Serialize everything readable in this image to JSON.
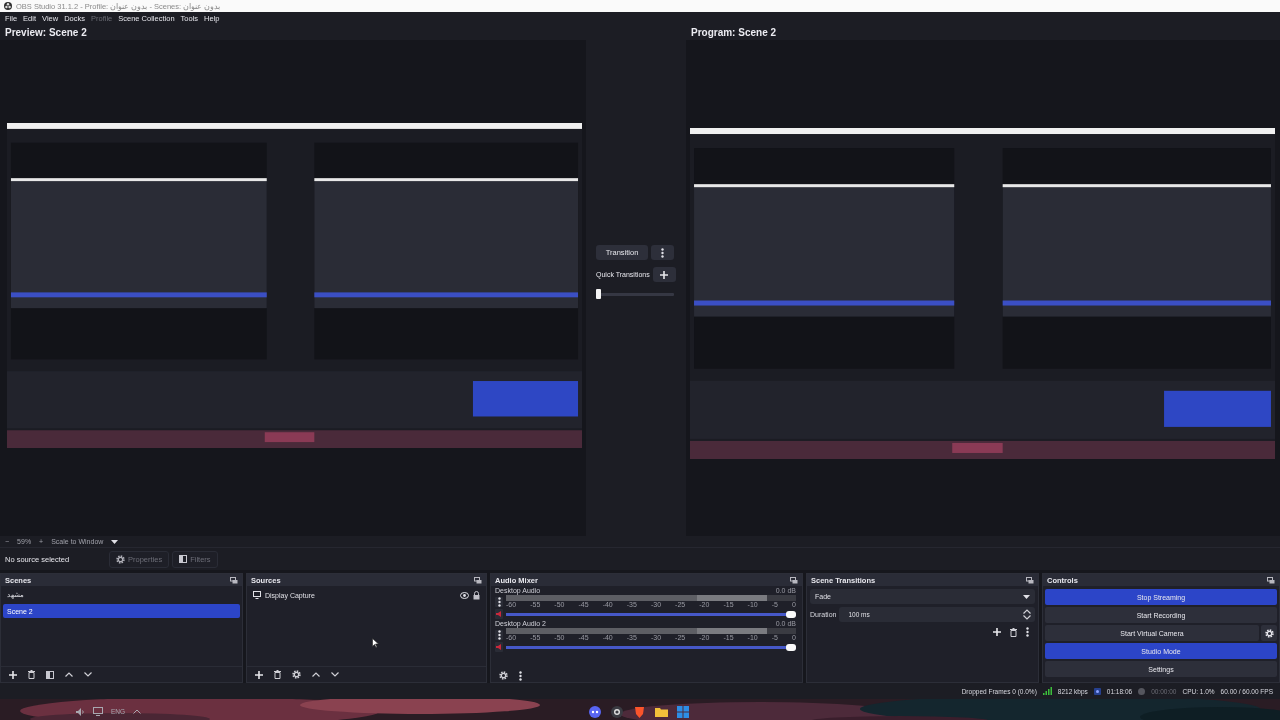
{
  "window": {
    "title": "OBS Studio 31.1.2 - Profile: بدون عنوان - Scenes: بدون عنوان"
  },
  "menu": [
    {
      "label": "File",
      "disabled": false
    },
    {
      "label": "Edit",
      "disabled": false
    },
    {
      "label": "View",
      "disabled": false
    },
    {
      "label": "Docks",
      "disabled": false
    },
    {
      "label": "Profile",
      "disabled": true
    },
    {
      "label": "Scene Collection",
      "disabled": false
    },
    {
      "label": "Tools",
      "disabled": false
    },
    {
      "label": "Help",
      "disabled": false
    }
  ],
  "preview": {
    "title": "Preview: Scene 2",
    "zoom_out": "−",
    "zoom": "59%",
    "zoom_in": "+",
    "scale_mode": "Scale to Window"
  },
  "transition_panel": {
    "transition_button": "Transition",
    "quick_transitions": "Quick Transitions",
    "level": 0
  },
  "program": {
    "title": "Program: Scene 2"
  },
  "source_toolbar": {
    "status": "No source selected",
    "buttons": [
      {
        "label": "Properties",
        "disabled": true,
        "kind": "gear"
      },
      {
        "label": "Filters",
        "disabled": true,
        "kind": "filter"
      }
    ]
  },
  "scenes": {
    "title": "Scenes",
    "items": [
      {
        "label": "مشهد",
        "selected": false
      },
      {
        "label": "Scene 2",
        "selected": true
      }
    ]
  },
  "sources": {
    "title": "Sources",
    "items": [
      {
        "label": "Display Capture",
        "selected": false
      }
    ]
  },
  "audio_mixer": {
    "title": "Audio Mixer",
    "channels": [
      {
        "name": "Desktop Audio",
        "reading": "0.0 dB",
        "level": 1,
        "muted": true,
        "scale": [
          "-60",
          "-55",
          "-50",
          "-45",
          "-40",
          "-35",
          "-30",
          "-25",
          "-20",
          "-15",
          "-10",
          "-5",
          "0"
        ]
      },
      {
        "name": "Desktop Audio 2",
        "reading": "0.0 dB",
        "level": 1,
        "muted": true,
        "scale": [
          "-60",
          "-55",
          "-50",
          "-45",
          "-40",
          "-35",
          "-30",
          "-25",
          "-20",
          "-15",
          "-10",
          "-5",
          "0"
        ]
      }
    ]
  },
  "scene_transitions": {
    "title": "Scene Transitions",
    "transition": "Fade",
    "duration_label": "Duration",
    "duration": "100 ms"
  },
  "controls": {
    "title": "Controls",
    "buttons": [
      {
        "label": "Stop Streaming",
        "active": true,
        "kind": "plain"
      },
      {
        "label": "Start Recording",
        "active": false,
        "kind": "plain"
      },
      {
        "label": "Start Virtual Camera",
        "active": false,
        "kind": "with_settings"
      },
      {
        "label": "Studio Mode",
        "active": true,
        "kind": "plain"
      },
      {
        "label": "Settings",
        "active": false,
        "kind": "plain"
      }
    ]
  },
  "status_bar": {
    "dropped_frames": "Dropped Frames 0 (0.0%)",
    "bitrate": "8212 kbps",
    "stream_time": "01:18:06",
    "record_time": "00:00:00",
    "cpu": "CPU: 1.0%",
    "fps": "60.00 / 60.00 FPS"
  },
  "taskbar": {
    "language": "ENG"
  }
}
